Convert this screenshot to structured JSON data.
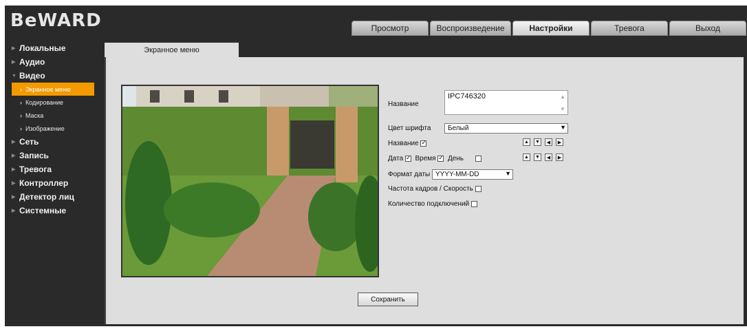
{
  "header": {
    "logo": "BeWARD"
  },
  "topnav": [
    {
      "label": "Просмотр",
      "active": false
    },
    {
      "label": "Воспроизведение",
      "active": false
    },
    {
      "label": "Настройки",
      "active": true
    },
    {
      "label": "Тревога",
      "active": false
    },
    {
      "label": "Выход",
      "active": false
    }
  ],
  "sidebar": {
    "items": [
      {
        "label": "Локальные"
      },
      {
        "label": "Аудио"
      },
      {
        "label": "Видео"
      },
      {
        "label": "Сеть"
      },
      {
        "label": "Запись"
      },
      {
        "label": "Тревога"
      },
      {
        "label": "Контроллер"
      },
      {
        "label": "Детектор лиц"
      },
      {
        "label": "Системные"
      }
    ],
    "video_sub": [
      {
        "label": "Экранное меню",
        "active": true
      },
      {
        "label": "Кодирование",
        "active": false
      },
      {
        "label": "Маска",
        "active": false
      },
      {
        "label": "Изображение",
        "active": false
      }
    ]
  },
  "content_tab": "Экранное меню",
  "form": {
    "name_label": "Название",
    "name_value": "IPC746320",
    "font_color_label": "Цвет шрифта",
    "font_color_value": "Белый",
    "show_name_label": "Название",
    "show_name_checked": true,
    "date_label": "Дата",
    "date_checked": true,
    "time_label": "Время",
    "time_checked": true,
    "day_label": "День",
    "day_checked": false,
    "date_format_label": "Формат даты",
    "date_format_value": "YYYY-MM-DD",
    "fps_label": "Частота кадров / Скорость",
    "fps_checked": false,
    "connections_label": "Количество подключений",
    "connections_checked": false
  },
  "save_label": "Сохранить"
}
